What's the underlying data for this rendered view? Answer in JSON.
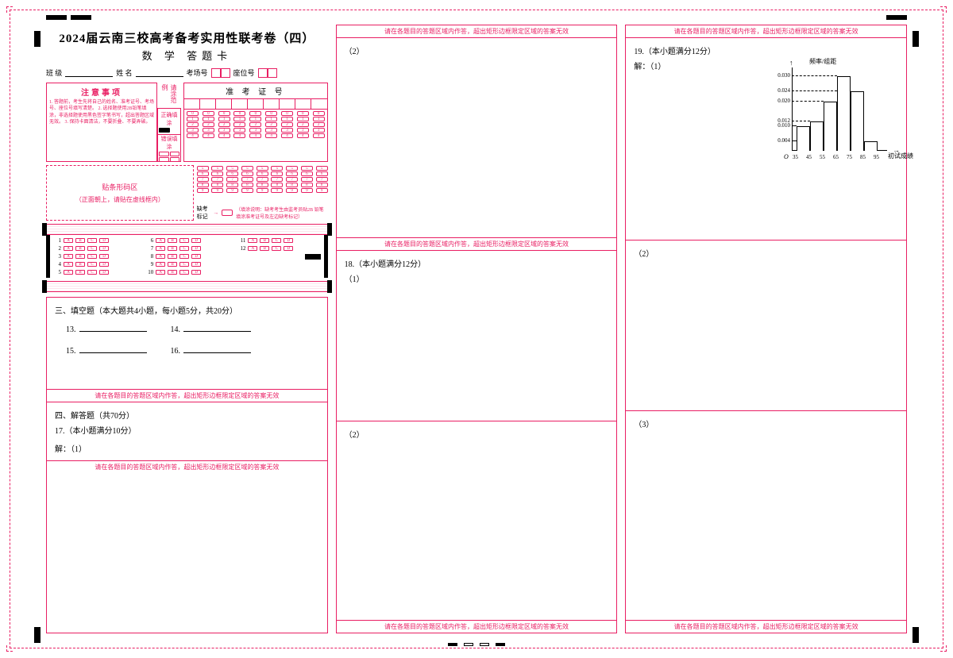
{
  "title": "2024届云南三校高考备考实用性联考卷（四）",
  "subtitle": "数 学 答题卡",
  "labels": {
    "class": "班 级",
    "name": "姓 名",
    "room": "考场号",
    "seat": "座位号",
    "notice_title": "注意事项",
    "notice_body": "1. 答题前，考生先将自己的姓名、准考证号、考场号、座位号填写清楚。\n2. 选择题使用2B铅笔填涂，非选择题使用黑色签字笔书写，超出答题区域无效。\n3. 保持卡面清洁，不要折叠、不要弄破。",
    "fill_label": "请涂范例",
    "correct_fill": "正确填涂",
    "wrong_fill": "错误填涂",
    "admit_card": "准 考 证 号",
    "barcode_line1": "贴条形码区",
    "barcode_line2": "（正面朝上，请贴在虚线框内）",
    "absent_label": "缺考标记",
    "absent_note": "（填涂说明：缺考考生由监考员贴2B\n铅笔填涂准考证号及左边缺考标记）",
    "zone_notice": "请在各题目的答题区域内作答，超出矩形边框限定区域的答案无效"
  },
  "mcq_numbers": [
    "1",
    "2",
    "3",
    "4",
    "5",
    "6",
    "7",
    "8",
    "9",
    "10",
    "11",
    "12"
  ],
  "options": [
    "A",
    "B",
    "C",
    "D"
  ],
  "digits": [
    "0",
    "1",
    "2",
    "3",
    "4",
    "5",
    "6",
    "7",
    "8",
    "9"
  ],
  "section3": {
    "heading": "三、填空题（本大题共4小题，每小题5分，共20分）",
    "q13": "13.",
    "q14": "14.",
    "q15": "15.",
    "q16": "16."
  },
  "section4": {
    "heading": "四、解答题（共70分）",
    "q17": "17.（本小题满分10分）",
    "q17_sub": "解：（1）",
    "q17_sub2": "（2）",
    "q18": "18.（本小题满分12分）",
    "q18_sub1": "（1）",
    "q18_sub2": "（2）",
    "q19": "19.（本小题满分12分）",
    "q19_sub": "解：（1）",
    "q19_sub2": "（2）",
    "q19_sub3": "（3）"
  },
  "chart_data": {
    "type": "bar",
    "title": "",
    "xlabel": "初试成绩",
    "ylabel": "频率/组距",
    "categories": [
      "35-45",
      "45-55",
      "55-65",
      "65-75",
      "75-85",
      "85-95"
    ],
    "x_ticks": [
      35,
      45,
      55,
      65,
      75,
      85,
      95
    ],
    "values": [
      0.01,
      0.012,
      0.02,
      0.03,
      0.024,
      0.004
    ],
    "y_ticks": [
      0.004,
      0.01,
      0.012,
      0.02,
      0.024,
      0.03
    ],
    "ylim": [
      0,
      0.032
    ]
  }
}
